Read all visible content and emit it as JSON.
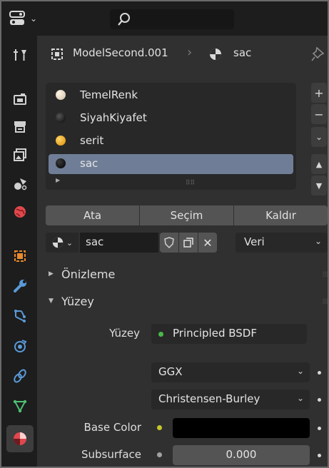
{
  "header": {
    "editor_icon": "properties-editor-icon",
    "search_placeholder": ""
  },
  "tabs": [
    {
      "name": "tool-tab",
      "icon": "tool-icon"
    },
    {
      "name": "render-tab",
      "icon": "render-icon"
    },
    {
      "name": "output-tab",
      "icon": "output-icon"
    },
    {
      "name": "view-layer-tab",
      "icon": "view-layer-icon"
    },
    {
      "name": "scene-tab",
      "icon": "scene-icon"
    },
    {
      "name": "world-tab",
      "icon": "world-icon"
    },
    {
      "name": "object-tab",
      "icon": "object-icon"
    },
    {
      "name": "modifier-tab",
      "icon": "wrench-icon"
    },
    {
      "name": "particles-tab",
      "icon": "particles-icon"
    },
    {
      "name": "physics-tab",
      "icon": "physics-icon"
    },
    {
      "name": "constraints-tab",
      "icon": "constraints-icon"
    },
    {
      "name": "data-tab",
      "icon": "mesh-data-icon"
    },
    {
      "name": "material-tab",
      "icon": "material-icon",
      "active": true
    }
  ],
  "breadcrumb": {
    "object": "ModelSecond.001",
    "separator": "›",
    "material": "sac"
  },
  "slots": [
    {
      "label": "TemelRenk",
      "color": "#e6d8c2"
    },
    {
      "label": "SiyahKiyafet",
      "color": "#111111"
    },
    {
      "label": "serit",
      "color": "#f0a800"
    },
    {
      "label": "sac",
      "color": "#0a0a0a",
      "selected": true
    }
  ],
  "side_buttons": {
    "add": "+",
    "remove": "−",
    "specials": "⌄",
    "up": "▲",
    "down": "▼"
  },
  "actions": {
    "assign": "Ata",
    "select": "Seçim",
    "deselect": "Kaldır"
  },
  "material_row": {
    "name": "sac",
    "link": "Veri"
  },
  "panels": {
    "preview": "Önizleme",
    "surface": "Yüzey"
  },
  "surface": {
    "surface_label": "Yüzey",
    "surface_value": "Principled BSDF",
    "distribution": "GGX",
    "subsurface_method": "Christensen-Burley",
    "base_color_label": "Base Color",
    "base_color": "#000000",
    "subsurface_label": "Subsurface",
    "subsurface_value": "0.000"
  },
  "colors": {
    "accent_green": "#49b848",
    "accent_yellow": "#c7c729",
    "selection": "#6f7e96"
  }
}
